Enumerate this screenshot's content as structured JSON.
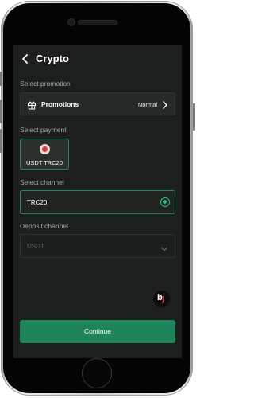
{
  "header": {
    "title": "Crypto"
  },
  "promotion": {
    "section_label": "Select promotion",
    "label": "Promotions",
    "value": "Normal"
  },
  "payment": {
    "section_label": "Select payment",
    "selected_method": "USDT TRC20"
  },
  "channel": {
    "section_label": "Select channel",
    "selected": "TRC20"
  },
  "deposit_channel": {
    "section_label": "Deposit channel",
    "value": "USDT"
  },
  "actions": {
    "continue_label": "Continue"
  },
  "colors": {
    "accent": "#20845a",
    "selected_border": "#1f8a5c",
    "radio": "#27c47f",
    "screen_bg": "#1c1f1d"
  },
  "icons": [
    "back-arrow-icon",
    "gift-icon",
    "chevron-right-icon",
    "usdt-trc20-icon",
    "radio-selected-icon",
    "chevron-down-icon",
    "brand-logo-icon"
  ]
}
